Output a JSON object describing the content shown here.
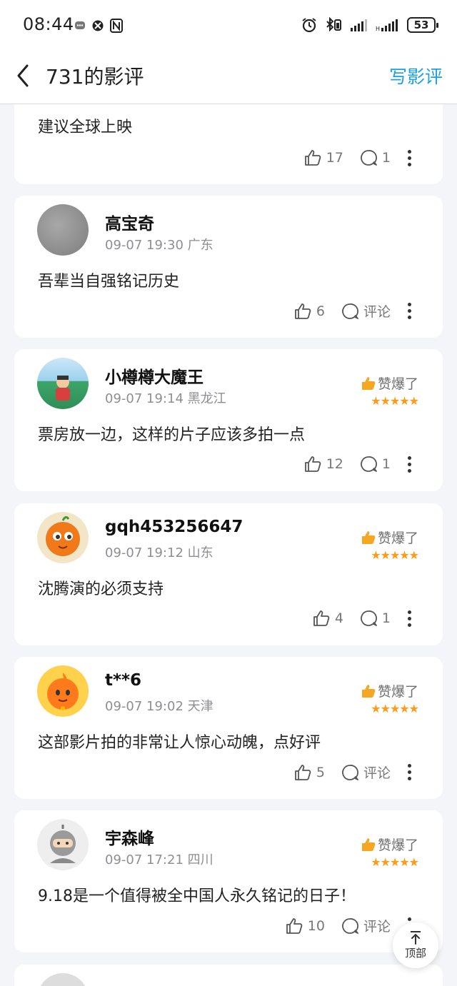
{
  "status_bar": {
    "time": "08:44",
    "battery": "53"
  },
  "header": {
    "title": "731的影评",
    "write_label": "写影评"
  },
  "reviews": [
    {
      "content": "建议全球上映",
      "likes": "17",
      "comments": "1"
    },
    {
      "user": "高宝奇",
      "meta": "09-07 19:30 广东",
      "content": "吾辈当自强铭记历史",
      "likes": "6",
      "comments": "评论"
    },
    {
      "user": "小樽樽大魔王",
      "meta": "09-07 19:14 黑龙江",
      "praise": "赞爆了",
      "stars": "★★★★★",
      "content": "票房放一边，这样的片子应该多拍一点",
      "likes": "12",
      "comments": "1"
    },
    {
      "user": "gqh453256647",
      "meta": "09-07 19:12 山东",
      "praise": "赞爆了",
      "stars": "★★★★★",
      "content": "沈腾演的必须支持",
      "likes": "4",
      "comments": "1"
    },
    {
      "user": "t**6",
      "meta": "09-07 19:02 天津",
      "praise": "赞爆了",
      "stars": "★★★★★",
      "content": "这部影片拍的非常让人惊心动魄，点好评",
      "likes": "5",
      "comments": "评论"
    },
    {
      "user": "宇森峰",
      "meta": "09-07 17:21 四川",
      "praise": "赞爆了",
      "stars": "★★★★★",
      "content": "9.18是一个值得被全中国人永久铭记的日子！",
      "likes": "10",
      "comments": "评论"
    }
  ],
  "top_button": {
    "label": "顶部"
  },
  "colors": {
    "accent": "#1aa0e8",
    "star": "#ff9a1a",
    "background": "#f4f5f9"
  }
}
